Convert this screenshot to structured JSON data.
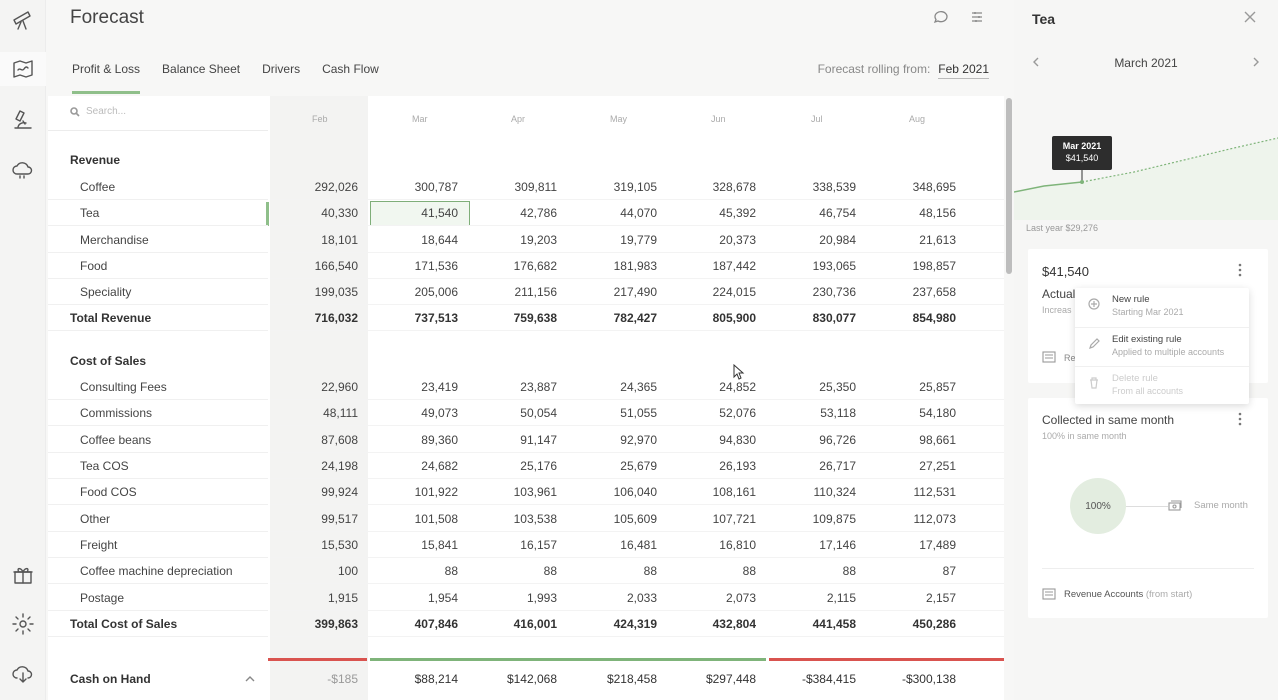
{
  "app": {
    "title": "Forecast"
  },
  "tabs": [
    "Profit & Loss",
    "Balance Sheet",
    "Drivers",
    "Cash Flow"
  ],
  "rolling": {
    "label": "Forecast rolling from:",
    "value": "Feb 2021"
  },
  "search": {
    "placeholder": "Search..."
  },
  "months": [
    "Feb",
    "Mar",
    "Apr",
    "May",
    "Jun",
    "Jul",
    "Aug"
  ],
  "revenue": {
    "heading": "Revenue",
    "rows": [
      {
        "label": "Coffee",
        "values": [
          "292,026",
          "300,787",
          "309,811",
          "319,105",
          "328,678",
          "338,539",
          "348,695"
        ]
      },
      {
        "label": "Tea",
        "values": [
          "40,330",
          "41,540",
          "42,786",
          "44,070",
          "45,392",
          "46,754",
          "48,156"
        ]
      },
      {
        "label": "Merchandise",
        "values": [
          "18,101",
          "18,644",
          "19,203",
          "19,779",
          "20,373",
          "20,984",
          "21,613"
        ]
      },
      {
        "label": "Food",
        "values": [
          "166,540",
          "171,536",
          "176,682",
          "181,983",
          "187,442",
          "193,065",
          "198,857"
        ]
      },
      {
        "label": "Speciality",
        "values": [
          "199,035",
          "205,006",
          "211,156",
          "217,490",
          "224,015",
          "230,736",
          "237,658"
        ]
      }
    ],
    "total": {
      "label": "Total Revenue",
      "values": [
        "716,032",
        "737,513",
        "759,638",
        "782,427",
        "805,900",
        "830,077",
        "854,980"
      ]
    }
  },
  "cost": {
    "heading": "Cost of Sales",
    "rows": [
      {
        "label": "Consulting Fees",
        "values": [
          "22,960",
          "23,419",
          "23,887",
          "24,365",
          "24,852",
          "25,350",
          "25,857"
        ]
      },
      {
        "label": "Commissions",
        "values": [
          "48,111",
          "49,073",
          "50,054",
          "51,055",
          "52,076",
          "53,118",
          "54,180"
        ]
      },
      {
        "label": "Coffee beans",
        "values": [
          "87,608",
          "89,360",
          "91,147",
          "92,970",
          "94,830",
          "96,726",
          "98,661"
        ]
      },
      {
        "label": "Tea COS",
        "values": [
          "24,198",
          "24,682",
          "25,176",
          "25,679",
          "26,193",
          "26,717",
          "27,251"
        ]
      },
      {
        "label": "Food COS",
        "values": [
          "99,924",
          "101,922",
          "103,961",
          "106,040",
          "108,161",
          "110,324",
          "112,531"
        ]
      },
      {
        "label": "Other",
        "values": [
          "99,517",
          "101,508",
          "103,538",
          "105,609",
          "107,721",
          "109,875",
          "112,073"
        ]
      },
      {
        "label": "Freight",
        "values": [
          "15,530",
          "15,841",
          "16,157",
          "16,481",
          "16,810",
          "17,146",
          "17,489"
        ]
      },
      {
        "label": "Coffee machine depreciation",
        "values": [
          "100",
          "88",
          "88",
          "88",
          "88",
          "88",
          "87"
        ]
      },
      {
        "label": "Postage",
        "values": [
          "1,915",
          "1,954",
          "1,993",
          "2,033",
          "2,073",
          "2,115",
          "2,157"
        ]
      }
    ],
    "total": {
      "label": "Total Cost of Sales",
      "values": [
        "399,863",
        "407,846",
        "416,001",
        "424,319",
        "432,804",
        "441,458",
        "450,286"
      ]
    }
  },
  "cash": {
    "label": "Cash on Hand",
    "values": [
      "-$185",
      "$88,214",
      "$142,068",
      "$218,458",
      "$297,448",
      "-$384,415",
      "-$300,138"
    ]
  },
  "colors": {
    "positive": "#7fb47a",
    "negative": "#d9534f",
    "accent": "#8fbf8a"
  },
  "panel": {
    "title": "Tea",
    "month": "March 2021",
    "tooltip": {
      "period": "Mar 2021",
      "value": "$41,540"
    },
    "last_year": "Last year $29,276",
    "card1": {
      "amount": "$41,540",
      "actual": "Actual",
      "increase": "Increas",
      "rev": "Re"
    },
    "menu": [
      {
        "title": "New rule",
        "subtitle": "Starting Mar 2021",
        "icon": "plus-circle-icon"
      },
      {
        "title": "Edit existing rule",
        "subtitle": "Applied to multiple accounts",
        "icon": "pencil-icon"
      },
      {
        "title": "Delete rule",
        "subtitle": "From all accounts",
        "icon": "trash-icon"
      }
    ],
    "card2": {
      "title": "Collected in same month",
      "subtitle": "100% in same month",
      "pie_value": "100%",
      "same_month": "Same month",
      "accounts": "Revenue Accounts",
      "accounts_note": "(from start)"
    }
  }
}
